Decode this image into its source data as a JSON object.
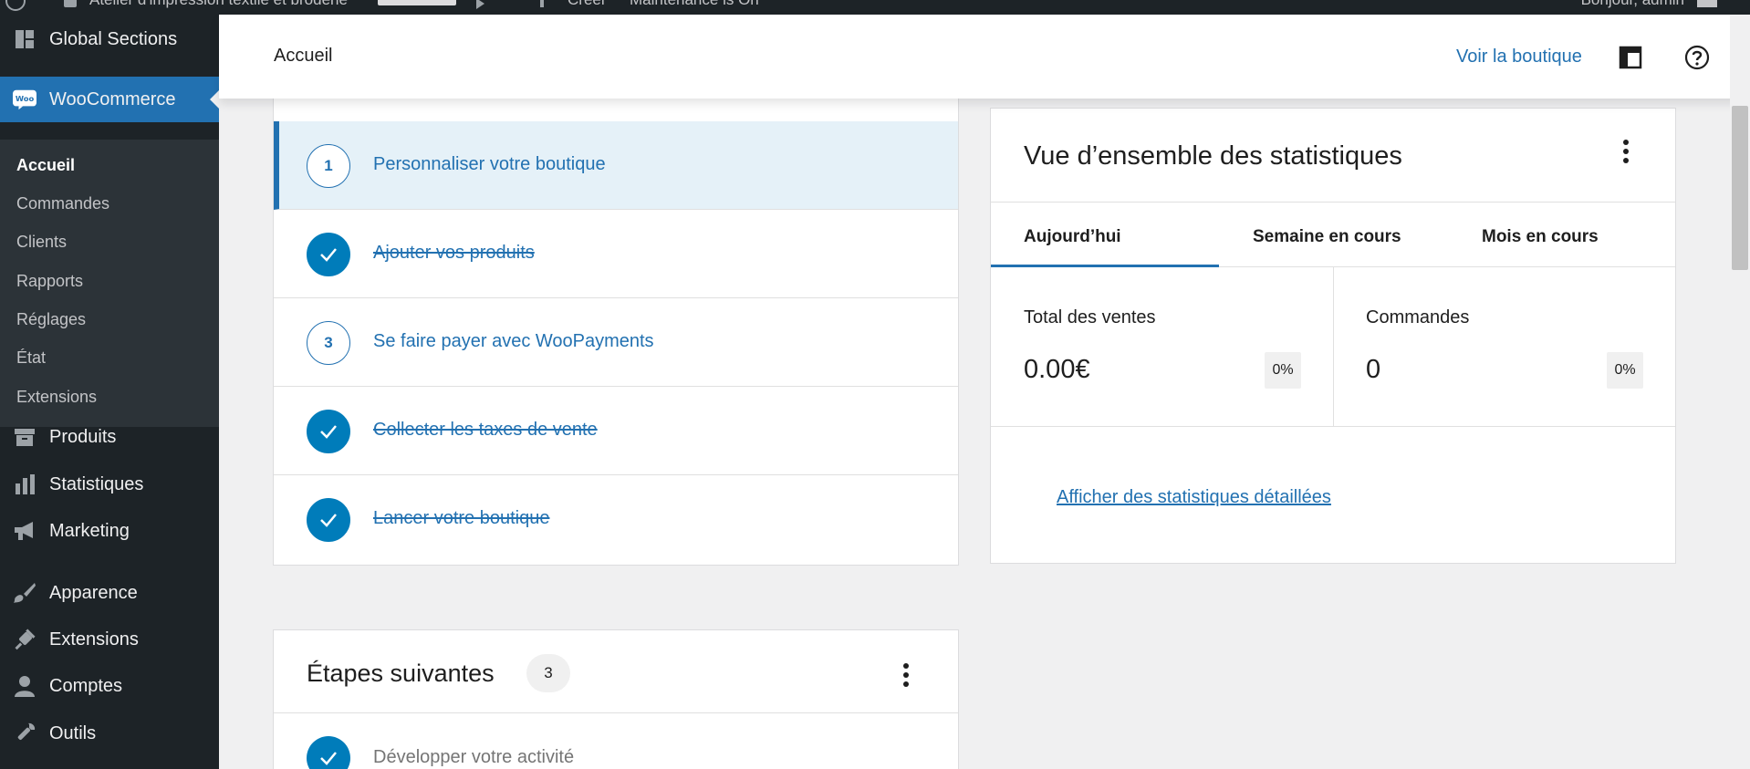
{
  "admin_bar": {
    "site_name": "Atelier d'impression textile et broderie",
    "new_label": "Créer",
    "maintenance": "Maintenance is On",
    "howdy": "Bonjour, admin"
  },
  "sidebar": {
    "top_items": [
      {
        "label": "Global Sections",
        "icon": "layout-grid-icon"
      },
      {
        "label": "WooCommerce",
        "icon": "woo-icon"
      }
    ],
    "submenu": [
      {
        "label": "Accueil",
        "current": true
      },
      {
        "label": "Commandes"
      },
      {
        "label": "Clients"
      },
      {
        "label": "Rapports"
      },
      {
        "label": "Réglages"
      },
      {
        "label": "État"
      },
      {
        "label": "Extensions"
      }
    ],
    "bottom_items": [
      {
        "label": "Produits",
        "icon": "archive-icon"
      },
      {
        "label": "Statistiques",
        "icon": "bar-chart-icon"
      },
      {
        "label": "Marketing",
        "icon": "megaphone-icon"
      },
      {
        "label": "Apparence",
        "icon": "paintbrush-icon"
      },
      {
        "label": "Extensions",
        "icon": "plugin-icon"
      },
      {
        "label": "Comptes",
        "icon": "user-icon"
      },
      {
        "label": "Outils",
        "icon": "wrench-icon"
      }
    ]
  },
  "header": {
    "title": "Accueil",
    "shop_link": "Voir la boutique"
  },
  "tasks": [
    {
      "number": "1",
      "label": "Personnaliser votre boutique",
      "done": false,
      "active": true
    },
    {
      "number": "",
      "label": "Ajouter vos produits",
      "done": true
    },
    {
      "number": "3",
      "label": "Se faire payer avec WooPayments",
      "done": false
    },
    {
      "number": "",
      "label": "Collecter les taxes de vente",
      "done": true
    },
    {
      "number": "",
      "label": "Lancer votre boutique",
      "done": true
    }
  ],
  "next_steps": {
    "title": "Étapes suivantes",
    "count": "3",
    "first_item": "Développer votre activité"
  },
  "stats": {
    "title": "Vue d’ensemble des statistiques",
    "tabs": [
      "Aujourd’hui",
      "Semaine en cours",
      "Mois en cours"
    ],
    "active_tab": 0,
    "metrics": [
      {
        "label": "Total des ventes",
        "value": "0.00€",
        "delta": "0%"
      },
      {
        "label": "Commandes",
        "value": "0",
        "delta": "0%"
      }
    ],
    "detail_link": "Afficher des statistiques détaillées"
  },
  "colors": {
    "accent": "#2271b1",
    "sidebar_bg": "#1d2327",
    "submenu_bg": "#2c3338",
    "done_badge": "#007cba"
  }
}
